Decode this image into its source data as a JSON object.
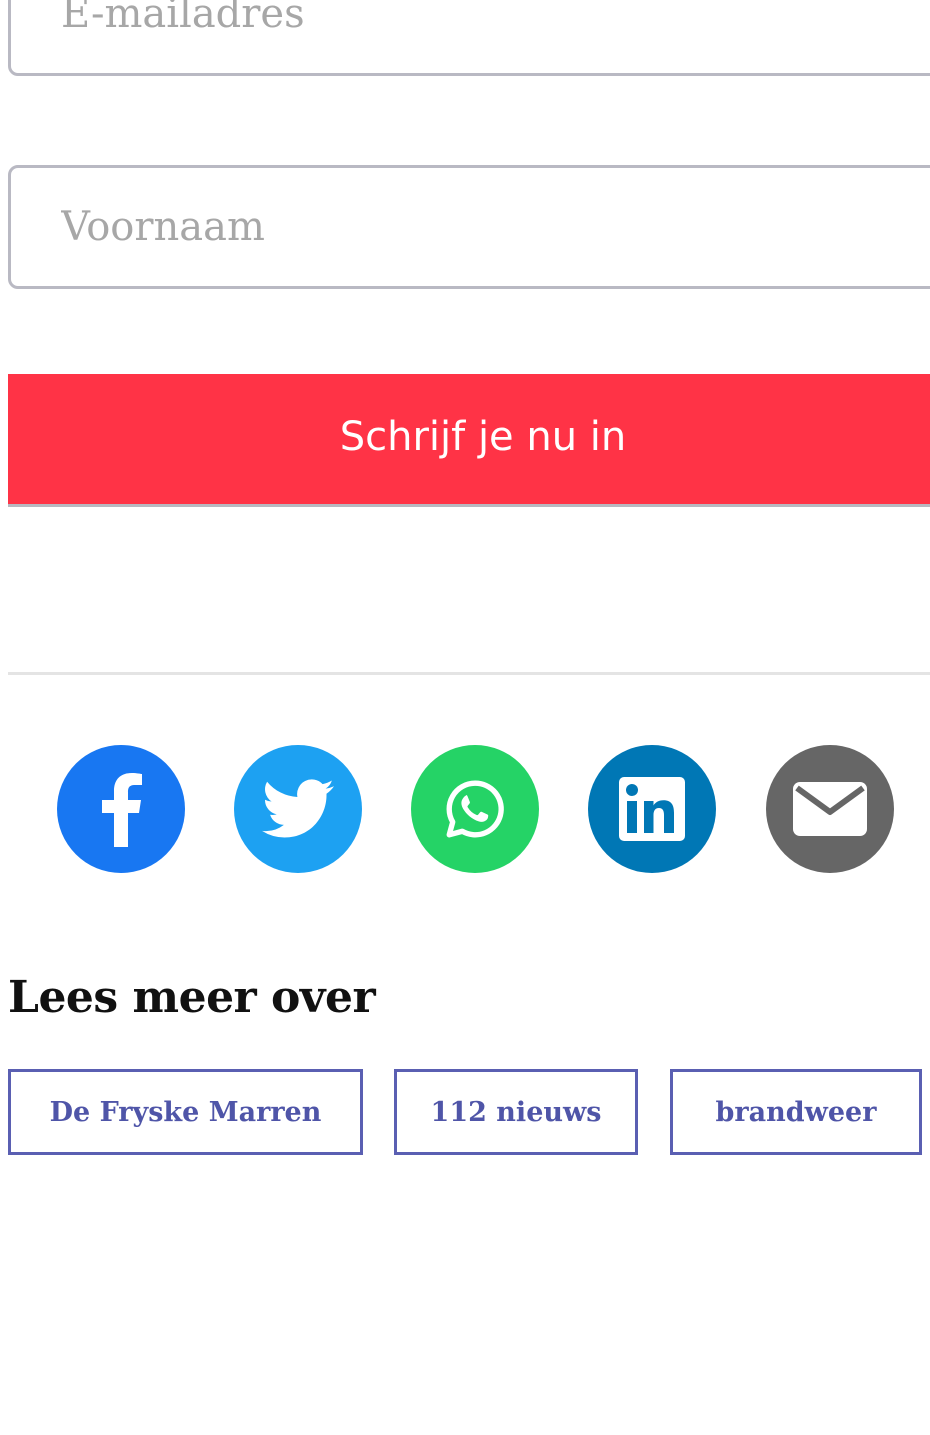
{
  "form": {
    "email_placeholder": "E-mailadres",
    "firstname_placeholder": "Voornaam",
    "subscribe_label": "Schrijf je nu in"
  },
  "share": {
    "buttons": [
      {
        "name": "facebook",
        "icon": "facebook-icon",
        "color": "#1877f2"
      },
      {
        "name": "twitter",
        "icon": "twitter-icon",
        "color": "#1da1f2"
      },
      {
        "name": "whatsapp",
        "icon": "whatsapp-icon",
        "color": "#25d366"
      },
      {
        "name": "linkedin",
        "icon": "linkedin-icon",
        "color": "#0077b5"
      },
      {
        "name": "email",
        "icon": "mail-icon",
        "color": "#666666"
      }
    ]
  },
  "read_more": {
    "title": "Lees meer over",
    "tags": [
      "De Fryske Marren",
      "112 nieuws",
      "brandweer"
    ]
  },
  "colors": {
    "accent": "#ff3346",
    "tag_border": "#5a5fb2",
    "field_border": "#b9b9c3"
  }
}
